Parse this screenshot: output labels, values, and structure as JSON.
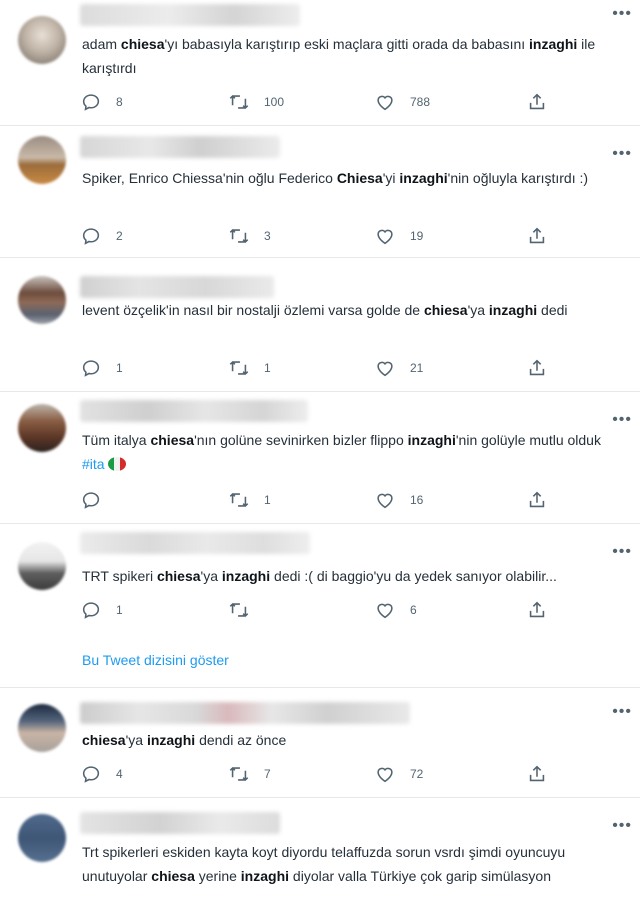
{
  "colors": {
    "link": "#1d9bf0",
    "text": "#0f1419",
    "muted": "#536471"
  },
  "icons": {
    "more": "more-horizontal-icon",
    "reply": "reply-icon",
    "retweet": "retweet-icon",
    "like": "heart-icon",
    "share": "share-icon"
  },
  "more_label": "•••",
  "tweets": [
    {
      "parts": [
        {
          "t": "adam "
        },
        {
          "b": "chiesa"
        },
        {
          "t": "'yı babasıyla karıştırıp eski maçlara gitti orada da babasını "
        },
        {
          "b": "inzaghi"
        },
        {
          "t": " ile karıştırdı"
        }
      ],
      "replies": "8",
      "retweets": "100",
      "likes": "788"
    },
    {
      "parts": [
        {
          "t": "Spiker, Enrico Chiessa'nin oğlu Federico "
        },
        {
          "b": "Chiesa"
        },
        {
          "t": "'yi "
        },
        {
          "b": "inzaghi"
        },
        {
          "t": "'nin oğluyla karıştırdı :)"
        }
      ],
      "replies": "2",
      "retweets": "3",
      "likes": "19"
    },
    {
      "parts": [
        {
          "t": "levent özçelik'in nasıl bir nostalji özlemi varsa golde de "
        },
        {
          "b": "chiesa"
        },
        {
          "t": "'ya "
        },
        {
          "b": "inzaghi"
        },
        {
          "t": " dedi"
        }
      ],
      "replies": "1",
      "retweets": "1",
      "likes": "21"
    },
    {
      "parts": [
        {
          "t": "Tüm italya "
        },
        {
          "b": "chiesa"
        },
        {
          "t": "'nın golüne sevinirken bizler flippo "
        },
        {
          "b": "inzaghi"
        },
        {
          "t": "'nin golüyle mutlu olduk "
        },
        {
          "h": "#ita"
        }
      ],
      "flag_after": true,
      "replies": "",
      "retweets": "1",
      "likes": "16"
    },
    {
      "parts": [
        {
          "t": "TRT spikeri "
        },
        {
          "b": "chiesa"
        },
        {
          "t": "'ya "
        },
        {
          "b": "inzaghi"
        },
        {
          "t": " dedi :( di baggio'yu da yedek sanıyor olabilir..."
        }
      ],
      "replies": "1",
      "retweets": "",
      "likes": "6",
      "thread_link": "Bu Tweet dizisini göster"
    },
    {
      "parts": [
        {
          "b": "chiesa"
        },
        {
          "t": "'ya "
        },
        {
          "b": "inzaghi"
        },
        {
          "t": " dendi az önce"
        }
      ],
      "replies": "4",
      "retweets": "7",
      "likes": "72"
    },
    {
      "parts": [
        {
          "t": "Trt spikerleri eskiden kayta koyt diyordu telaffuzda sorun vsrdı şimdi oyuncuyu unutuyolar "
        },
        {
          "b": "chiesa"
        },
        {
          "t": " yerine "
        },
        {
          "b": "inzaghi"
        },
        {
          "t": " diyolar valla Türkiye çok garip simülasyon"
        }
      ]
    }
  ]
}
